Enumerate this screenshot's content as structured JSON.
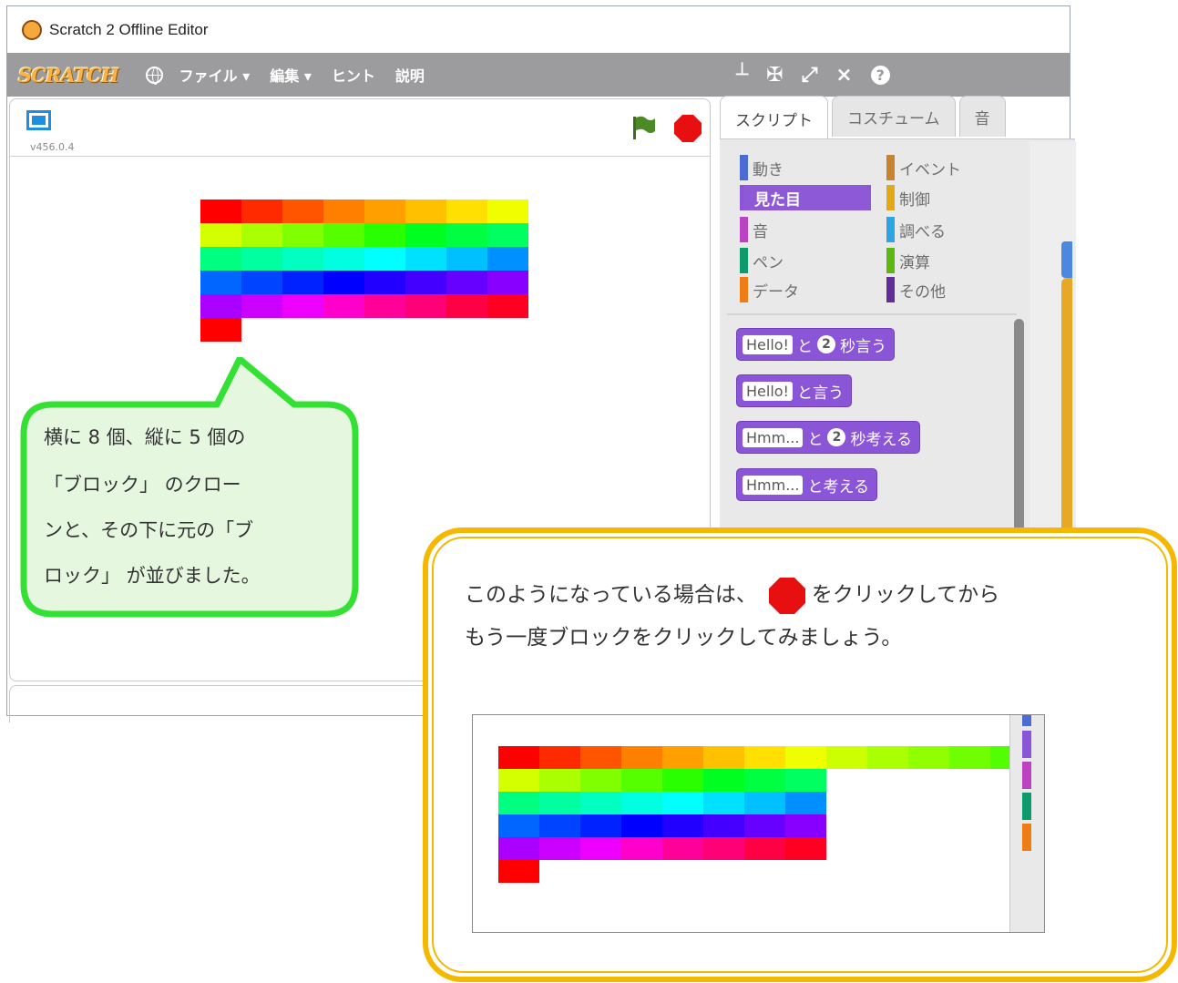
{
  "window": {
    "title": "Scratch 2 Offline Editor"
  },
  "menubar": {
    "logo": "SCRATCH",
    "items": [
      "ファイル ▾",
      "編集 ▾",
      "ヒント",
      "説明"
    ],
    "toolbar_icons": [
      "duplicate-icon",
      "delete-icon",
      "grow-icon",
      "shrink-icon",
      "help-icon"
    ]
  },
  "stage": {
    "version": "v456.0.4"
  },
  "tabs": [
    "スクリプト",
    "コスチューム",
    "音"
  ],
  "categories": {
    "left": [
      {
        "label": "動き",
        "color": "#4a6cd4"
      },
      {
        "label": "見た目",
        "color": "#8a55d7"
      },
      {
        "label": "音",
        "color": "#bb42c3"
      },
      {
        "label": "ペン",
        "color": "#0e9a6c"
      },
      {
        "label": "データ",
        "color": "#ee7d16"
      }
    ],
    "right": [
      {
        "label": "イベント",
        "color": "#c88330"
      },
      {
        "label": "制御",
        "color": "#e1a91a"
      },
      {
        "label": "調べる",
        "color": "#2ca5e2"
      },
      {
        "label": "演算",
        "color": "#5cb712"
      },
      {
        "label": "その他",
        "color": "#632d99"
      }
    ],
    "active": "見た目"
  },
  "blocks": [
    {
      "input": "Hello!",
      "num": "2",
      "tail": "と",
      "tail2": "秒言う"
    },
    {
      "input": "Hello!",
      "tail": "と言う"
    },
    {
      "input": "Hmm...",
      "num": "2",
      "tail": "と",
      "tail2": "秒考える"
    },
    {
      "input": "Hmm...",
      "tail": "と考える"
    }
  ],
  "callout_green": {
    "lines": [
      "横に 8 個、縦に 5 個の",
      "「ブロック」 のクロー",
      "ンと、その下に元の「ブ",
      "ロック」 が並びました。"
    ]
  },
  "note": {
    "line1_before": "このようになっている場合は、",
    "line1_after": "をクリックしてから",
    "line2": "もう一度ブロックをクリックしてみましょう。"
  },
  "grid_colors": {
    "stage_rows": [
      [
        "#ff0000",
        "#ff2a00",
        "#ff5500",
        "#ff7f00",
        "#ffa000",
        "#ffc000",
        "#ffe000",
        "#f0ff00"
      ],
      [
        "#d4ff00",
        "#aaff00",
        "#80ff00",
        "#55ff00",
        "#2aff00",
        "#00ff20",
        "#00ff40",
        "#00ff60"
      ],
      [
        "#00ff80",
        "#00ffa0",
        "#00ffc0",
        "#00ffe0",
        "#00ffff",
        "#00e0ff",
        "#00c0ff",
        "#0090ff"
      ],
      [
        "#0066ff",
        "#0044ff",
        "#0022ff",
        "#0000ff",
        "#2200ff",
        "#4400ff",
        "#6600ff",
        "#8800ff"
      ],
      [
        "#aa00ff",
        "#cc00ff",
        "#ee00ff",
        "#ff00cc",
        "#ff0099",
        "#ff0077",
        "#ff0044",
        "#ff0022"
      ]
    ],
    "thumb_top_extra": [
      "#ccff00",
      "#aaff00",
      "#90ff00",
      "#70ff00",
      "#50ff00",
      "#30ff00",
      "#ff0000"
    ]
  }
}
